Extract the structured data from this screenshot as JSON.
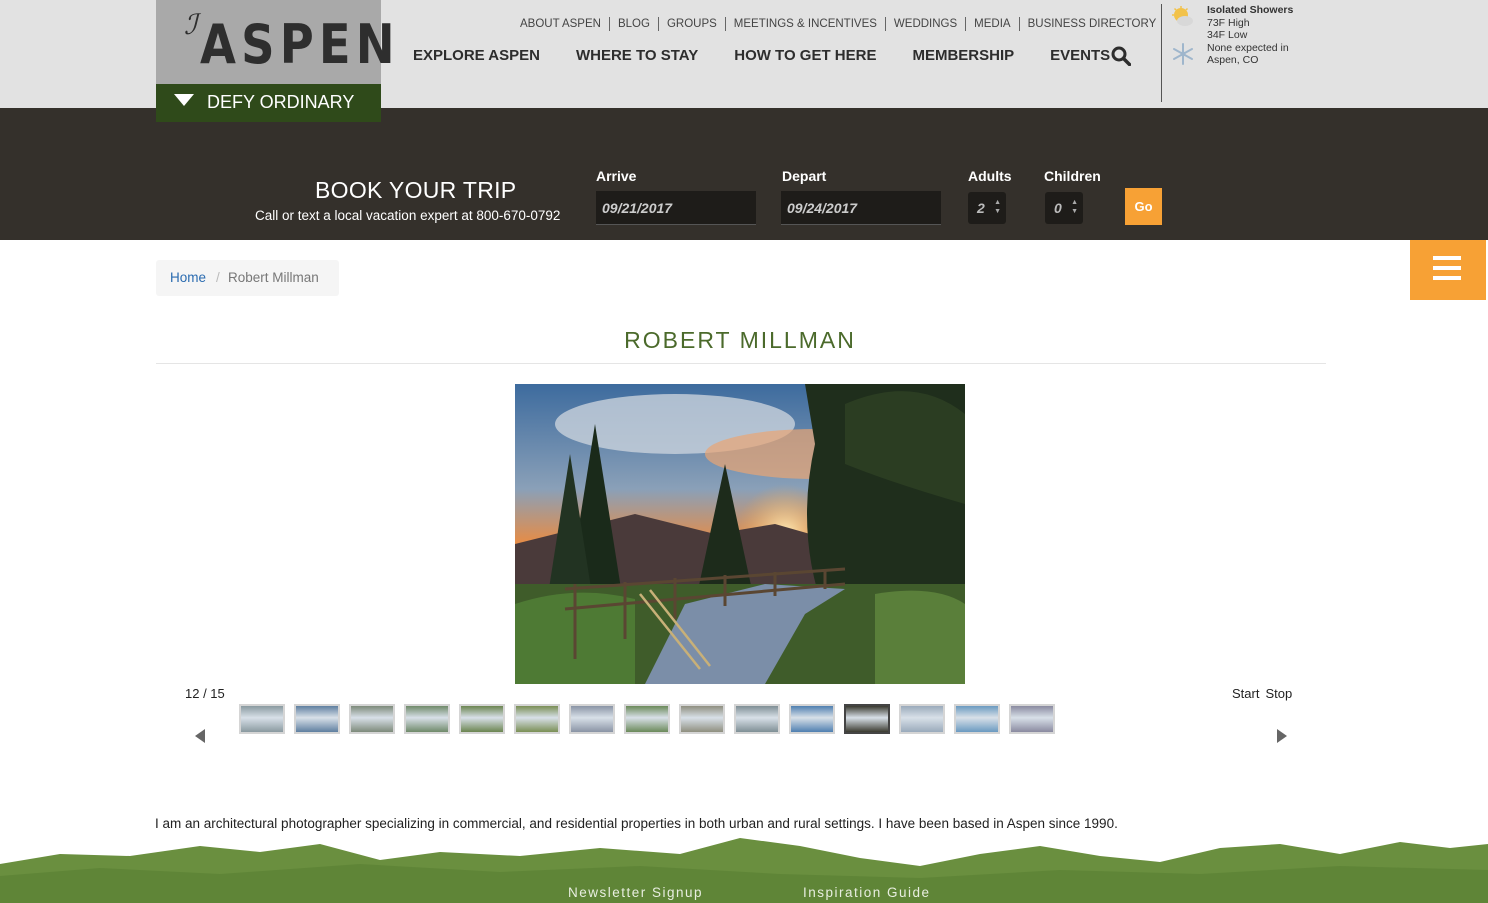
{
  "brand": {
    "logo_mark": "ℐ",
    "logo_text": "ASPEN",
    "tagline": "DEFY ORDINARY"
  },
  "top_nav": [
    "ABOUT ASPEN",
    "BLOG",
    "GROUPS",
    "MEETINGS & INCENTIVES",
    "WEDDINGS",
    "MEDIA",
    "BUSINESS DIRECTORY"
  ],
  "main_nav": [
    "EXPLORE ASPEN",
    "WHERE TO STAY",
    "HOW TO GET HERE",
    "MEMBERSHIP",
    "EVENTS"
  ],
  "weather": {
    "condition": "Isolated Showers",
    "high": "73F High",
    "low": "34F Low",
    "snow_line1": "None expected in",
    "snow_line2": "Aspen, CO"
  },
  "booking": {
    "title": "BOOK YOUR TRIP",
    "subtitle": "Call or text a local vacation expert at 800-670-0792",
    "arrive_label": "Arrive",
    "arrive_value": "09/21/2017",
    "depart_label": "Depart",
    "depart_value": "09/24/2017",
    "adults_label": "Adults",
    "adults_value": "2",
    "children_label": "Children",
    "children_value": "0",
    "go_label": "Go"
  },
  "breadcrumb": {
    "home": "Home",
    "separator": "/",
    "current": "Robert Millman"
  },
  "page_title": "ROBERT MILLMAN",
  "slideshow": {
    "counter": "12 / 15",
    "start_label": "Start",
    "stop_label": "Stop",
    "active_index": 11,
    "thumb_colors": [
      "#8a9aa0",
      "#5f7fa0",
      "#7d8a7a",
      "#6f8a6a",
      "#6b8550",
      "#7a8f55",
      "#8a94a5",
      "#6b8a5a",
      "#8f8f7f",
      "#7f8f95",
      "#4f7fb0",
      "#3a3a30",
      "#9aaabb",
      "#6a9ac0",
      "#8a8aa0"
    ]
  },
  "bio": "I am an architectural photographer specializing in commercial,  and residential properties in both urban and rural settings. I have been based in Aspen since 1990.",
  "footer": {
    "newsletter": "Newsletter Signup",
    "inspiration": "Inspiration Guide"
  }
}
